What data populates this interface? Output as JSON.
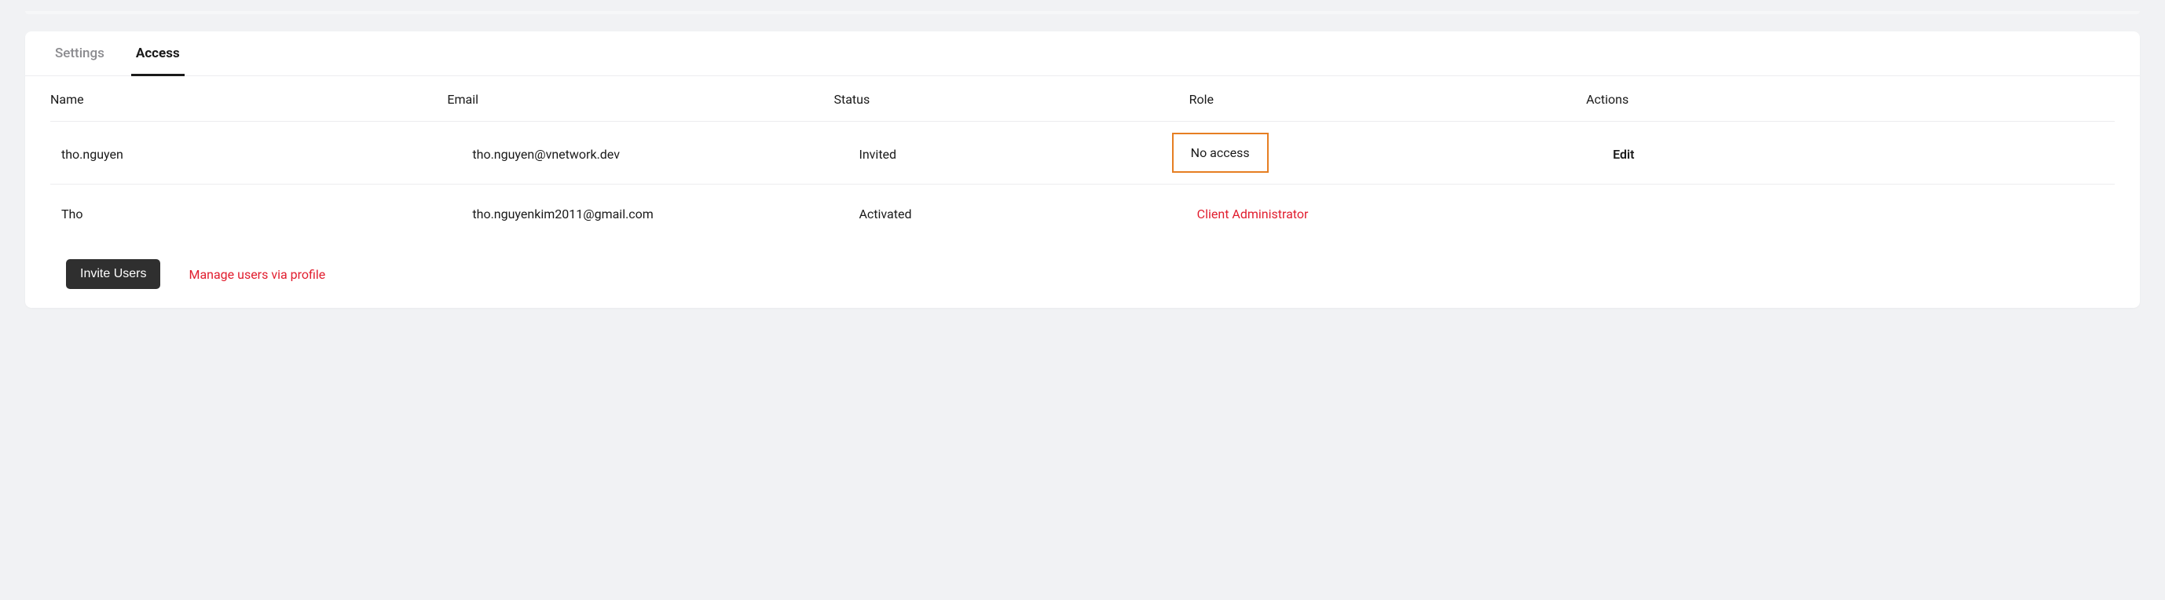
{
  "tabs": [
    {
      "label": "Settings",
      "active": false
    },
    {
      "label": "Access",
      "active": true
    }
  ],
  "table": {
    "headers": {
      "name": "Name",
      "email": "Email",
      "status": "Status",
      "role": "Role",
      "actions": "Actions"
    },
    "rows": [
      {
        "name": "tho.nguyen",
        "email": "tho.nguyen@vnetwork.dev",
        "status": "Invited",
        "role": "No access",
        "role_highlighted": true,
        "role_admin": false,
        "action": "Edit"
      },
      {
        "name": "Tho",
        "email": "tho.nguyenkim2011@gmail.com",
        "status": "Activated",
        "role": "Client Administrator",
        "role_highlighted": false,
        "role_admin": true,
        "action": ""
      }
    ]
  },
  "footer": {
    "invite_button": "Invite Users",
    "manage_link": "Manage users via profile"
  }
}
